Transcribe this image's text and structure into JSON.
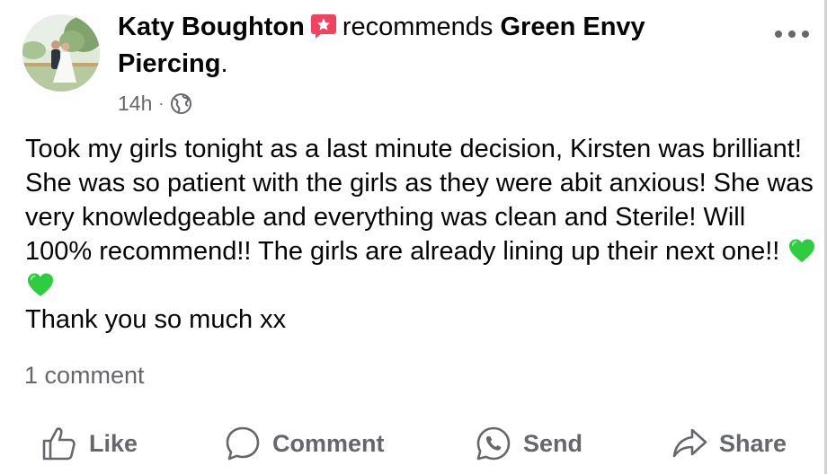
{
  "post": {
    "author": "Katy Boughton",
    "action_text": "recommends",
    "page_name": "Green Envy Piercing",
    "page_suffix": ".",
    "time": "14h",
    "separator": "·",
    "audience_icon": "globe-icon",
    "recommend_icon": "recommend-star-icon",
    "more_icon": "more-options-icon",
    "body_text": "Took my girls tonight as a last minute decision, Kirsten was brilliant! She was so patient with the girls as they were abit anxious! She was very knowledgeable and everything was clean and Sterile! Will 100% recommend!! The girls are already lining up their next one!!",
    "body_emoji": [
      "green-heart",
      "green-heart"
    ],
    "body_closing": "Thank you so much xx",
    "comments_count": "1 comment"
  },
  "actions": {
    "like_label": "Like",
    "comment_label": "Comment",
    "send_label": "Send",
    "share_label": "Share"
  },
  "colors": {
    "text_primary": "#050505",
    "text_secondary": "#65676b",
    "recommend_badge": "#f3425f",
    "heart_green": "#2ecc40",
    "divider": "#d0d2d6"
  }
}
